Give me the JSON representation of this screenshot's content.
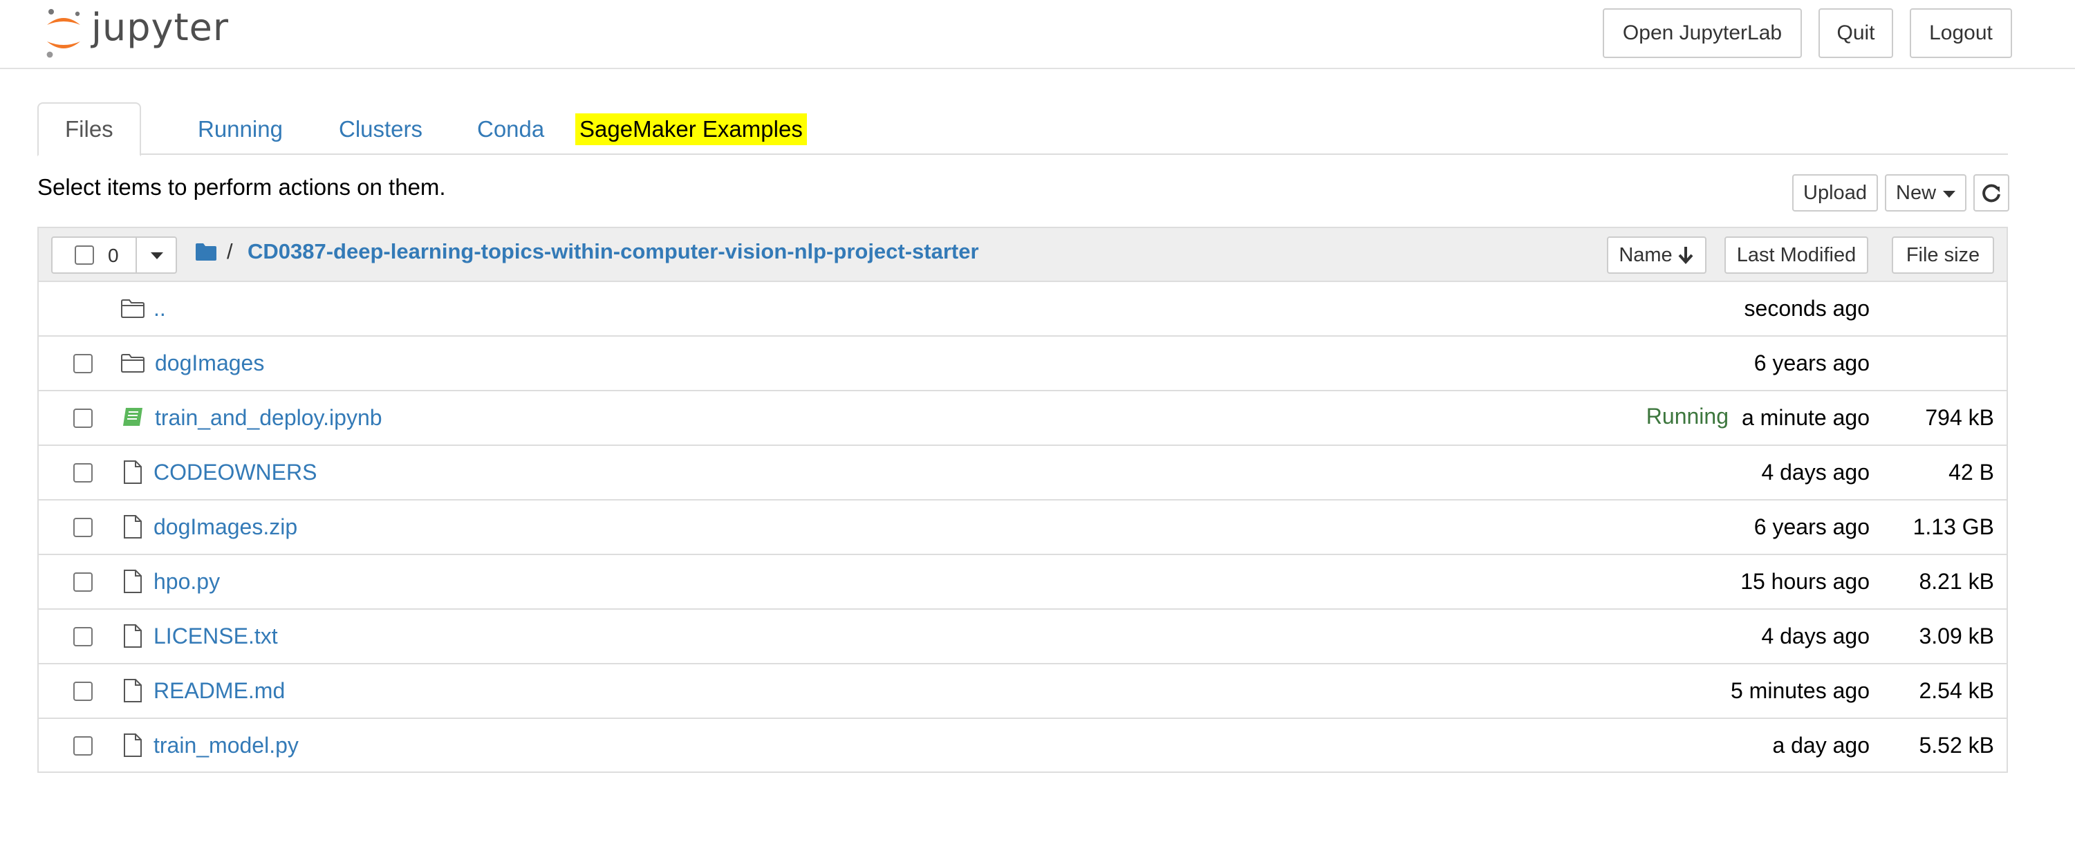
{
  "header": {
    "logo_text": "jupyter",
    "buttons": {
      "open_jupyterlab": "Open JupyterLab",
      "quit": "Quit",
      "logout": "Logout"
    }
  },
  "tabs": [
    {
      "label": "Files",
      "active": true
    },
    {
      "label": "Running"
    },
    {
      "label": "Clusters"
    },
    {
      "label": "Conda"
    },
    {
      "label": "SageMaker Examples",
      "highlighted": true
    }
  ],
  "toolbar": {
    "hint": "Select items to perform actions on them.",
    "upload": "Upload",
    "new": "New",
    "refresh_icon": "refresh-icon"
  },
  "file_list": {
    "selected_count": "0",
    "breadcrumb_separator": "/",
    "path": "CD0387-deep-learning-topics-within-computer-vision-nlp-project-starter",
    "sort_buttons": {
      "name": "Name",
      "last_modified": "Last Modified",
      "file_size": "File size"
    },
    "rows": [
      {
        "type": "parent",
        "icon": "folder-icon",
        "name": "..",
        "status": "",
        "modified": "seconds ago",
        "size": ""
      },
      {
        "type": "folder",
        "icon": "folder-icon",
        "name": "dogImages",
        "status": "",
        "modified": "6 years ago",
        "size": ""
      },
      {
        "type": "notebook",
        "icon": "notebook-icon",
        "name": "train_and_deploy.ipynb",
        "status": "Running",
        "modified": "a minute ago",
        "size": "794 kB"
      },
      {
        "type": "file",
        "icon": "file-icon",
        "name": "CODEOWNERS",
        "status": "",
        "modified": "4 days ago",
        "size": "42 B"
      },
      {
        "type": "file",
        "icon": "file-icon",
        "name": "dogImages.zip",
        "status": "",
        "modified": "6 years ago",
        "size": "1.13 GB"
      },
      {
        "type": "file",
        "icon": "file-icon",
        "name": "hpo.py",
        "status": "",
        "modified": "15 hours ago",
        "size": "8.21 kB"
      },
      {
        "type": "file",
        "icon": "file-icon",
        "name": "LICENSE.txt",
        "status": "",
        "modified": "4 days ago",
        "size": "3.09 kB"
      },
      {
        "type": "file",
        "icon": "file-icon",
        "name": "README.md",
        "status": "",
        "modified": "5 minutes ago",
        "size": "2.54 kB"
      },
      {
        "type": "file",
        "icon": "file-icon",
        "name": "train_model.py",
        "status": "",
        "modified": "a day ago",
        "size": "5.52 kB"
      }
    ]
  },
  "colors": {
    "link": "#337ab7",
    "running": "#3c763d",
    "highlight": "#ffff00",
    "logo_orange": "#f37726"
  }
}
